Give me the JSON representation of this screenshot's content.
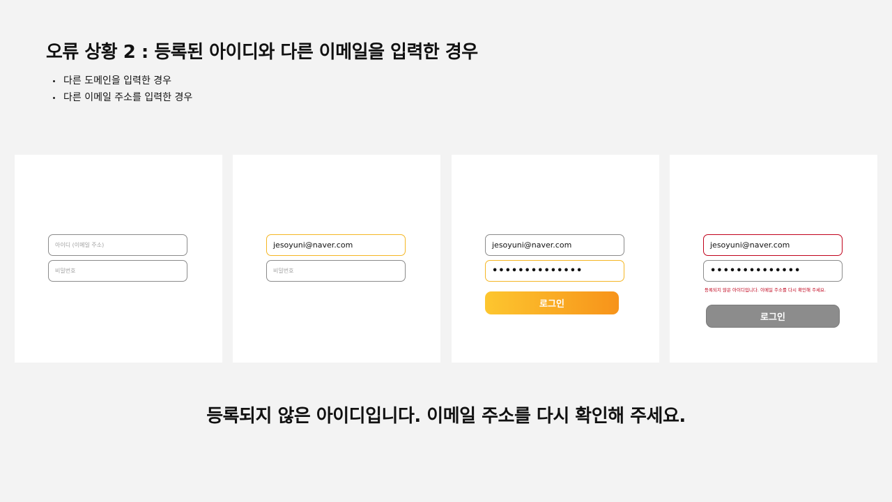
{
  "title": "오류 상황 2 : 등록된 아이디와 다른 이메일을 입력한 경우",
  "bullets": [
    "다른 도메인을 입력한 경우",
    "다른 이메일 주소를 입력한 경우"
  ],
  "panels": [
    {
      "id_field": {
        "value": "",
        "placeholder": "아이디 (이메일 주소)"
      },
      "pw_field": {
        "value": "",
        "placeholder": "비밀번호"
      }
    },
    {
      "id_field": {
        "value": "jesoyuni@naver.com"
      },
      "pw_field": {
        "value": "",
        "placeholder": "비밀번호"
      }
    },
    {
      "id_field": {
        "value": "jesoyuni@naver.com"
      },
      "pw_field": {
        "value": "••••••••••••••"
      },
      "login_button": "로그인"
    },
    {
      "id_field": {
        "value": "jesoyuni@naver.com"
      },
      "pw_field": {
        "value": "••••••••••••••"
      },
      "error_text": "등록되지 않은 아이디입니다. 이메일 주소를 다시 확인해 주세요.",
      "login_button": "로그인"
    }
  ],
  "error_message": "등록되지 않은 아이디입니다. 이메일 주소를 다시 확인해 주세요.",
  "colors": {
    "background": "#f3f3f3",
    "focus_border": "#f5b623",
    "error_border": "#c0001a",
    "button_gradient_start": "#fdc62f",
    "button_gradient_end": "#f7931a",
    "button_disabled": "#8c8c8c"
  }
}
